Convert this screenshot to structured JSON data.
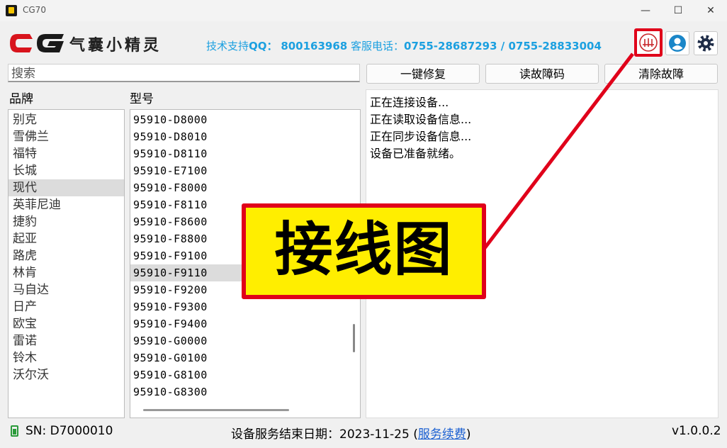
{
  "window": {
    "title": "CG70",
    "min": "—",
    "max": "☐",
    "close": "✕"
  },
  "header": {
    "logo_text": "CG",
    "app_name": "气囊小精灵",
    "support_label": "技术支持",
    "qq_label": "QQ：",
    "qq": "800163968",
    "phone_label": "客服电话：",
    "phones": "0755-28687293 / 0755-28833004"
  },
  "search": {
    "placeholder": "搜索"
  },
  "actions": {
    "repair": "一键修复",
    "read": "读故障码",
    "clear": "清除故障"
  },
  "brand_label": "品牌",
  "model_label": "型号",
  "brands": [
    "别克",
    "雪佛兰",
    "福特",
    "长城",
    "现代",
    "英菲尼迪",
    "捷豹",
    "起亚",
    "路虎",
    "林肯",
    "马自达",
    "日产",
    "欧宝",
    "雷诺",
    "铃木",
    "沃尔沃"
  ],
  "selected_brand_index": 4,
  "models": [
    "95910-D8000",
    "95910-D8010",
    "95910-D8110",
    "95910-E7100",
    "95910-F8000",
    "95910-F8110",
    "95910-F8600",
    "95910-F8800",
    "95910-F9100",
    "95910-F9110",
    "95910-F9200",
    "95910-F9300",
    "95910-F9400",
    "95910-G0000",
    "95910-G0100",
    "95910-G8100",
    "95910-G8300"
  ],
  "selected_model_index": 9,
  "log": [
    "正在连接设备...",
    "正在读取设备信息...",
    "正在同步设备信息...",
    "设备已准备就绪。"
  ],
  "callout": {
    "text": "接线图"
  },
  "status": {
    "sn": "SN: D7000010",
    "service_label": "设备服务结束日期：",
    "service_date": "2023-11-25",
    "open_paren": "(",
    "renew": "服务续费",
    "close_paren": ")",
    "version": "v1.0.0.2"
  },
  "colors": {
    "accent": "#1ca0e0",
    "callout_bg": "#ffee00",
    "callout_border": "#e0001a",
    "logo_red": "#d8141c"
  },
  "icons": [
    "wiring-diagram-icon",
    "user-icon",
    "gear-icon",
    "battery-icon"
  ]
}
